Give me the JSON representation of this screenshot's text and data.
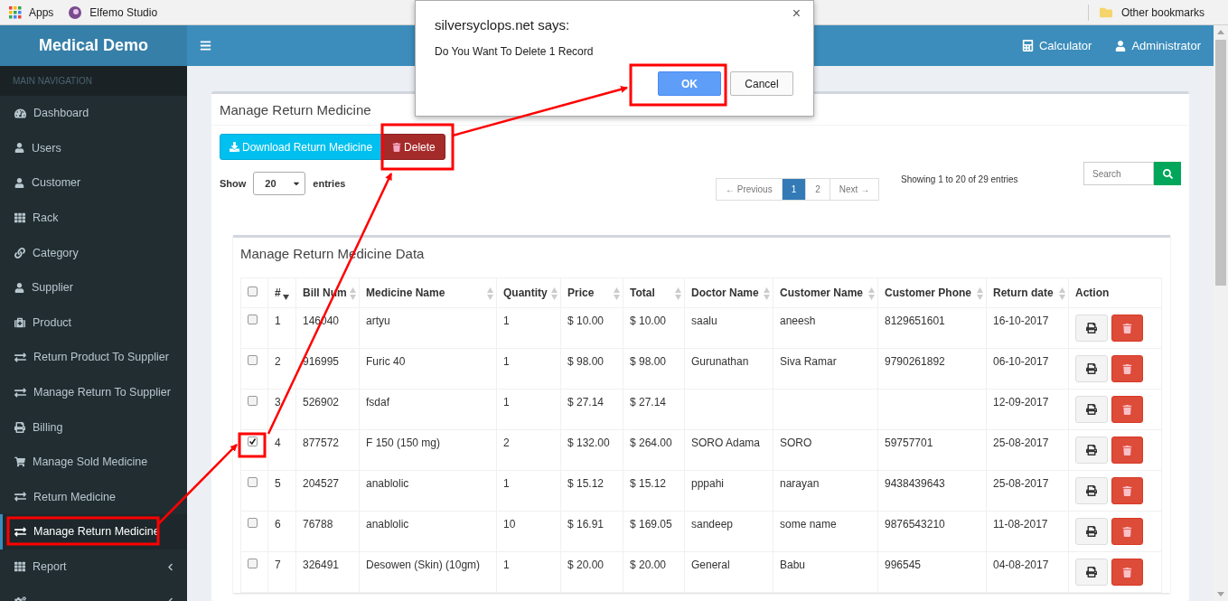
{
  "bookmarks_bar": {
    "items": [
      {
        "kind": "apps",
        "label": "Apps"
      },
      {
        "kind": "site",
        "label": "Elfemo Studio"
      }
    ],
    "other": "Other bookmarks"
  },
  "brand": "Medical Demo",
  "navbar": {
    "items": [
      {
        "kind": "calculator",
        "label": "Calculator"
      },
      {
        "kind": "user",
        "label": "Administrator"
      }
    ]
  },
  "sidebar": {
    "heading": "MAIN NAVIGATION",
    "items": [
      {
        "kind": "dashboard",
        "label": "Dashboard",
        "selected": false,
        "submenu": false
      },
      {
        "kind": "user",
        "label": "Users",
        "selected": false,
        "submenu": false
      },
      {
        "kind": "user",
        "label": "Customer",
        "selected": false,
        "submenu": false
      },
      {
        "kind": "grid",
        "label": "Rack",
        "selected": false,
        "submenu": false
      },
      {
        "kind": "link",
        "label": "Category",
        "selected": false,
        "submenu": false
      },
      {
        "kind": "user",
        "label": "Supplier",
        "selected": false,
        "submenu": false
      },
      {
        "kind": "medkit",
        "label": "Product",
        "selected": false,
        "submenu": false
      },
      {
        "kind": "exchange",
        "label": "Return Product To Supplier",
        "selected": false,
        "submenu": false
      },
      {
        "kind": "exchange",
        "label": "Manage Return To Supplier",
        "selected": false,
        "submenu": false
      },
      {
        "kind": "print",
        "label": "Billing",
        "selected": false,
        "submenu": false
      },
      {
        "kind": "cart",
        "label": "Manage Sold Medicine",
        "selected": false,
        "submenu": false
      },
      {
        "kind": "exchange",
        "label": "Return Medicine",
        "selected": false,
        "submenu": false
      },
      {
        "kind": "exchange",
        "label": "Manage Return Medicine",
        "selected": true,
        "submenu": false
      },
      {
        "kind": "grid",
        "label": "Report",
        "selected": false,
        "submenu": true
      },
      {
        "kind": "cog",
        "selected": false,
        "submenu": true
      }
    ]
  },
  "page": {
    "title": "Manage Return Medicine",
    "buttons": [
      {
        "kind": "download",
        "label": "Download Return Medicine"
      },
      {
        "kind": "delete",
        "label": "Delete"
      }
    ],
    "length": {
      "prefix": "Show",
      "value": "20",
      "suffix": "entries"
    },
    "pagination": [
      {
        "label": "← Previous",
        "selected": false
      },
      {
        "label": "1",
        "selected": true
      },
      {
        "label": "2",
        "selected": false
      },
      {
        "label": "Next →",
        "selected": false
      }
    ],
    "info": "Showing 1 to 20 of 29 entries",
    "search": {
      "placeholder": "Search"
    }
  },
  "table": {
    "title": "Manage Return Medicine Data",
    "header_checked": false,
    "columns": [
      {
        "label": "#",
        "sortable": true,
        "sorted": true
      },
      {
        "label": "Bill Num",
        "sortable": true,
        "sorted": false
      },
      {
        "label": "Medicine Name",
        "sortable": true,
        "sorted": false
      },
      {
        "label": "Quantity",
        "sortable": true,
        "sorted": false
      },
      {
        "label": "Price",
        "sortable": true,
        "sorted": false
      },
      {
        "label": "Total",
        "sortable": true,
        "sorted": false
      },
      {
        "label": "Doctor Name",
        "sortable": true,
        "sorted": false
      },
      {
        "label": "Customer Name",
        "sortable": true,
        "sorted": false
      },
      {
        "label": "Customer Phone",
        "sortable": true,
        "sorted": false
      },
      {
        "label": "Return date",
        "sortable": true,
        "sorted": false
      },
      {
        "label": "Action"
      }
    ],
    "rows": [
      {
        "checked": false,
        "cells": [
          "1",
          "146040",
          "artyu",
          "1",
          "$ 10.00",
          "$ 10.00",
          "saalu",
          "aneesh",
          "8129651601",
          "16-10-2017"
        ]
      },
      {
        "checked": false,
        "cells": [
          "2",
          "916995",
          "Furic 40",
          "1",
          "$ 98.00",
          "$ 98.00",
          "Gurunathan",
          "Siva Ramar",
          "9790261892",
          "06-10-2017"
        ]
      },
      {
        "checked": false,
        "cells": [
          "3",
          "526902",
          "fsdaf",
          "1",
          "$ 27.14",
          "$ 27.14",
          "",
          "",
          "",
          "12-09-2017"
        ]
      },
      {
        "checked": true,
        "cells": [
          "4",
          "877572",
          "F 150 (150 mg)",
          "2",
          "$ 132.00",
          "$ 264.00",
          "SORO Adama",
          "SORO",
          "59757701",
          "25-08-2017"
        ]
      },
      {
        "checked": false,
        "cells": [
          "5",
          "204527",
          "anablolic",
          "1",
          "$ 15.12",
          "$ 15.12",
          "pppahi",
          "narayan",
          "9438439643",
          "25-08-2017"
        ]
      },
      {
        "checked": false,
        "cells": [
          "6",
          "76788",
          "anablolic",
          "10",
          "$ 16.91",
          "$ 169.05",
          "sandeep",
          "some name",
          "9876543210",
          "11-08-2017"
        ]
      },
      {
        "checked": false,
        "cells": [
          "7",
          "326491",
          "Desowen (Skin) (10gm)",
          "1",
          "$ 20.00",
          "$ 20.00",
          "General",
          "Babu",
          "996545",
          "04-08-2017"
        ]
      }
    ]
  },
  "dialog": {
    "title": "silversyclops.net says:",
    "message": "Do You Want To Delete 1 Record",
    "close": "×",
    "buttons": [
      {
        "label": "OK",
        "selected": true
      },
      {
        "label": "Cancel",
        "selected": false
      }
    ]
  }
}
